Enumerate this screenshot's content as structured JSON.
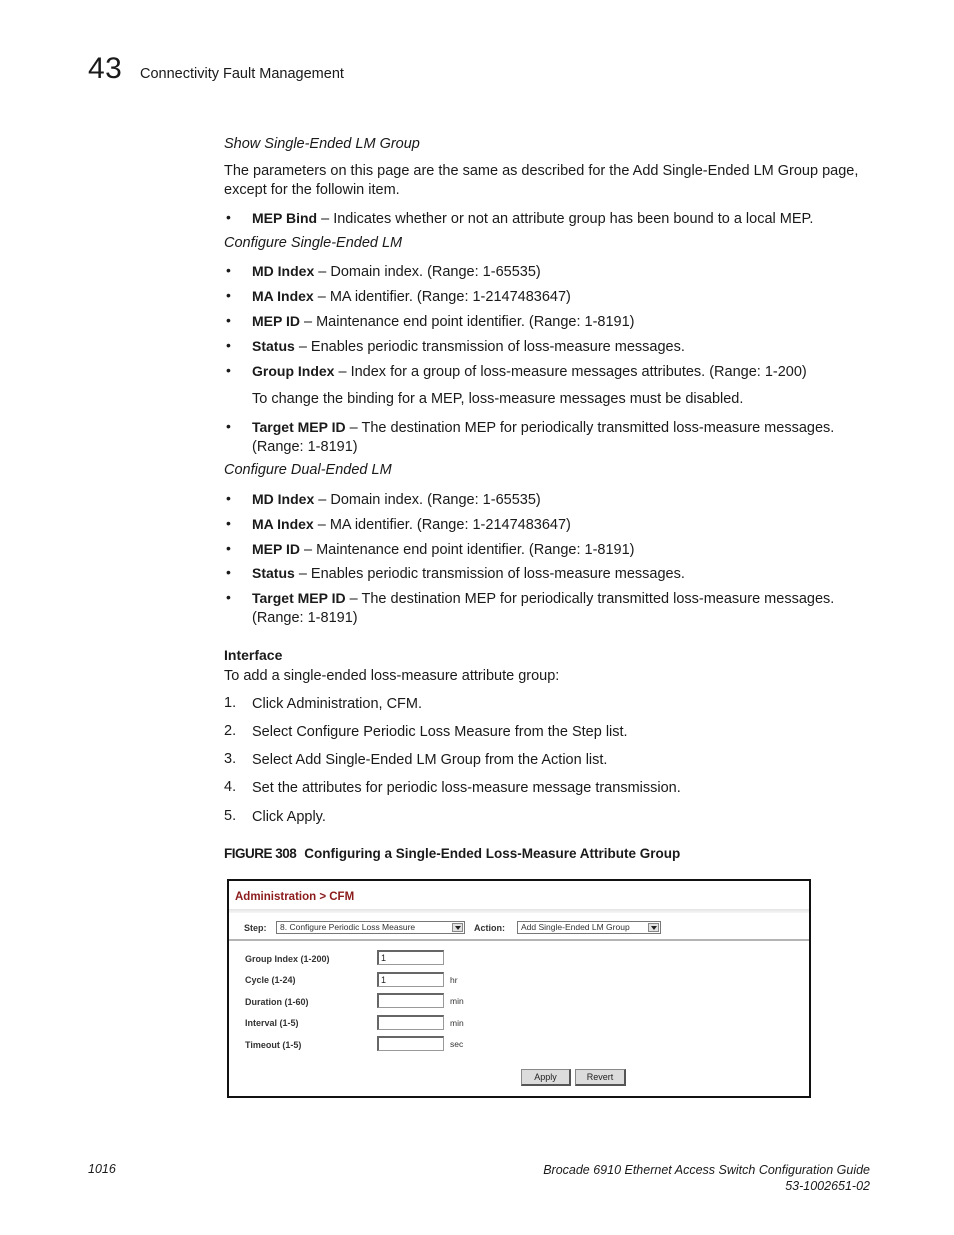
{
  "header": {
    "chapter_number": "43",
    "chapter_title": "Connectivity Fault Management"
  },
  "sections": {
    "show_single": {
      "heading": "Show Single-Ended LM Group",
      "paragraph_line1": "The parameters on this page are the same as described for the Add Single-Ended LM Group page,",
      "paragraph_line2": "except for the followin item.",
      "bullets": [
        {
          "term": "MEP Bind",
          "desc": " – Indicates whether or not an attribute group has been bound to a local MEP."
        }
      ]
    },
    "configure_single": {
      "heading": "Configure Single-Ended LM",
      "bullets": [
        {
          "term": "MD Index",
          "desc": " – Domain index. (Range: 1-65535)"
        },
        {
          "term": "MA Index",
          "desc": " – MA identifier. (Range: 1-2147483647)"
        },
        {
          "term": "MEP ID",
          "desc": " – Maintenance end point identifier. (Range: 1-8191)"
        },
        {
          "term": "Status",
          "desc": " – Enables periodic transmission of loss-measure messages."
        },
        {
          "term": "Group Index",
          "desc": " – Index for a group of loss-measure messages attributes. (Range: 1-200)"
        },
        {
          "term": "Target MEP ID",
          "desc": " – The destination MEP for periodically transmitted loss-measure messages.",
          "desc2": "(Range: 1-8191)"
        }
      ],
      "note": "To change the binding for a MEP, loss-measure messages must be disabled."
    },
    "configure_dual": {
      "heading": "Configure Dual-Ended LM",
      "bullets": [
        {
          "term": "MD Index",
          "desc": " – Domain index. (Range: 1-65535)"
        },
        {
          "term": "MA Index",
          "desc": " – MA identifier. (Range: 1-2147483647)"
        },
        {
          "term": "MEP ID",
          "desc": " – Maintenance end point identifier. (Range: 1-8191)"
        },
        {
          "term": "Status",
          "desc": " – Enables periodic transmission of loss-measure messages."
        },
        {
          "term": "Target MEP ID",
          "desc": " – The destination MEP for periodically transmitted loss-measure messages.",
          "desc2": "(Range: 1-8191)"
        }
      ]
    },
    "interface": {
      "heading": "Interface",
      "intro": "To add a single-ended loss-measure attribute group:",
      "steps": [
        {
          "num": "1.",
          "text": "Click Administration, CFM."
        },
        {
          "num": "2.",
          "text": "Select Configure Periodic Loss Measure from the Step list."
        },
        {
          "num": "3.",
          "text": "Select Add Single-Ended LM Group from the Action list."
        },
        {
          "num": "4.",
          "text": "Set the attributes for periodic loss-measure message transmission."
        },
        {
          "num": "5.",
          "text": "Click Apply."
        }
      ]
    }
  },
  "figure": {
    "label": "FIGURE 308",
    "caption": "Configuring a Single-Ended Loss-Measure Attribute Group",
    "breadcrumb": "Administration > CFM",
    "step_label": "Step:",
    "step_value": "8. Configure Periodic Loss Measure",
    "action_label": "Action:",
    "action_value": "Add Single-Ended LM Group",
    "fields": [
      {
        "label": "Group Index (1-200)",
        "value": "1",
        "unit": ""
      },
      {
        "label": "Cycle (1-24)",
        "value": "1",
        "unit": "hr"
      },
      {
        "label": "Duration (1-60)",
        "value": "",
        "unit": "min"
      },
      {
        "label": "Interval (1-5)",
        "value": "",
        "unit": "min"
      },
      {
        "label": "Timeout (1-5)",
        "value": "",
        "unit": "sec"
      }
    ],
    "apply_label": "Apply",
    "revert_label": "Revert",
    "breadcrumb_color": "#8b1a1a"
  },
  "footer": {
    "page_number": "1016",
    "doc_title": "Brocade 6910 Ethernet Access Switch Configuration Guide",
    "doc_number": "53-1002651-02"
  }
}
